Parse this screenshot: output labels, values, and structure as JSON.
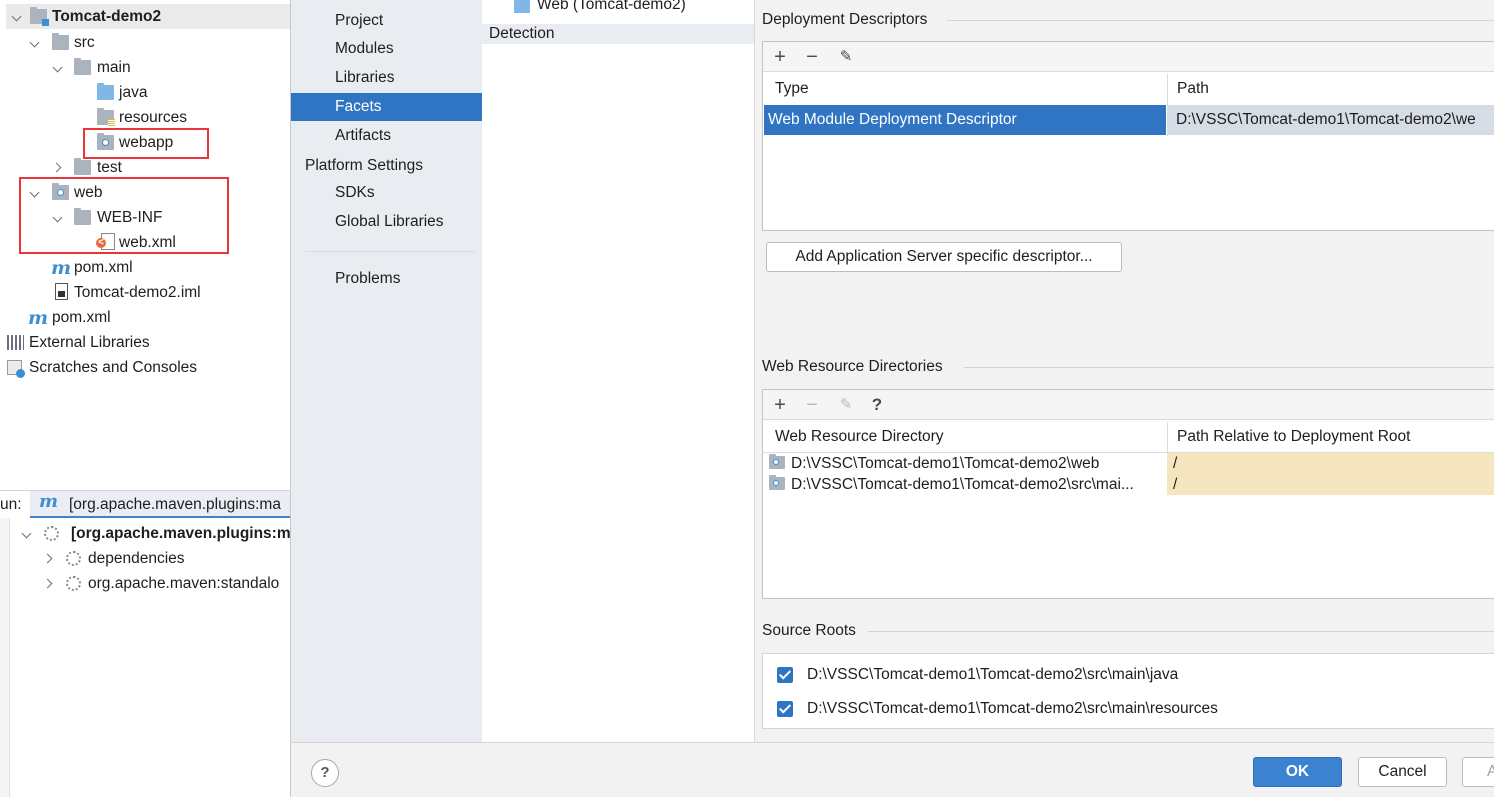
{
  "project_tree": {
    "root": "Tomcat-demo2",
    "src": "src",
    "main": "main",
    "java": "java",
    "resources": "resources",
    "webapp": "webapp",
    "test": "test",
    "web": "web",
    "web_inf": "WEB-INF",
    "web_xml": "web.xml",
    "pom_inner": "pom.xml",
    "iml": "Tomcat-demo2.iml",
    "pom_outer": "pom.xml",
    "external_libraries": "External Libraries",
    "scratches": "Scratches and Consoles"
  },
  "run_panel": {
    "prefix": "un:",
    "tab_label": "[org.apache.maven.plugins:ma",
    "root_item": "[org.apache.maven.plugins:m",
    "items": [
      "dependencies",
      "org.apache.maven:standalo"
    ]
  },
  "dialog_sidebar": {
    "items": [
      "Project",
      "Modules",
      "Libraries",
      "Facets",
      "Artifacts"
    ],
    "selected": "Facets",
    "platform_heading": "Platform Settings",
    "platform_items": [
      "SDKs",
      "Global Libraries"
    ],
    "problems": "Problems"
  },
  "facets_list": {
    "web_facet": "Web (Tomcat-demo2)",
    "detection": "Detection"
  },
  "deployment_descriptors": {
    "title": "Deployment Descriptors",
    "col_type": "Type",
    "col_path": "Path",
    "row_type": "Web Module Deployment Descriptor",
    "row_path": "D:\\VSSC\\Tomcat-demo1\\Tomcat-demo2\\we",
    "add_server_button": "Add Application Server specific descriptor..."
  },
  "web_resource_directories": {
    "title": "Web Resource Directories",
    "col_dir": "Web Resource Directory",
    "col_rel": "Path Relative to Deployment Root",
    "rows": [
      {
        "dir": "D:\\VSSC\\Tomcat-demo1\\Tomcat-demo2\\web",
        "rel": "/"
      },
      {
        "dir": "D:\\VSSC\\Tomcat-demo1\\Tomcat-demo2\\src\\mai...",
        "rel": "/"
      }
    ]
  },
  "source_roots": {
    "title": "Source Roots",
    "items": [
      {
        "path": "D:\\VSSC\\Tomcat-demo1\\Tomcat-demo2\\src\\main\\java",
        "checked": true
      },
      {
        "path": "D:\\VSSC\\Tomcat-demo1\\Tomcat-demo2\\src\\main\\resources",
        "checked": true
      }
    ]
  },
  "buttons": {
    "help": "?",
    "ok": "OK",
    "cancel": "Cancel",
    "apply_partial": "A"
  },
  "colors": {
    "selection": "#2f75c4",
    "highlight_box": "#e8343a",
    "relative_path_bg": "#f5e6bf",
    "primary_button": "#3b82d1"
  }
}
